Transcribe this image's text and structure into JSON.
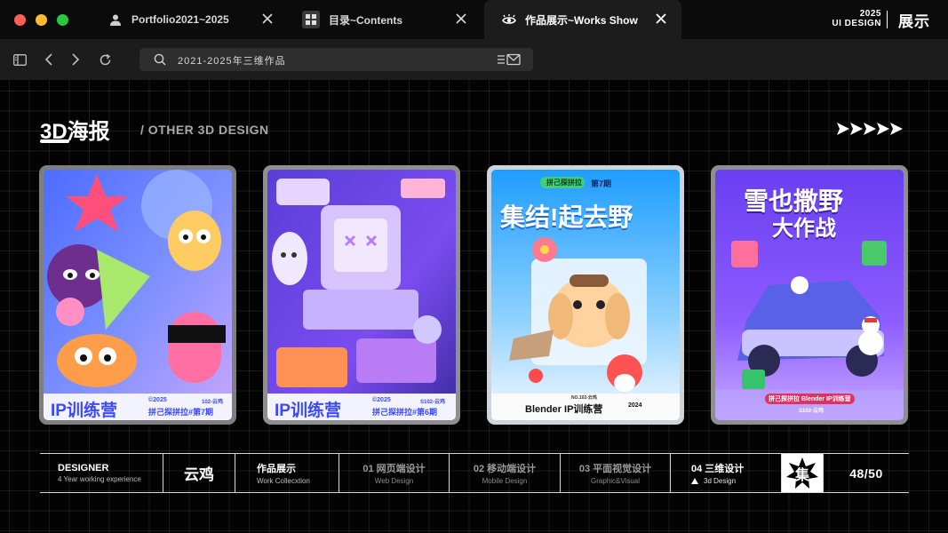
{
  "window": {
    "lights": [
      "#fe5f57",
      "#febc2e",
      "#28c840"
    ]
  },
  "tabs": [
    {
      "label": "Portfolio2021~2025",
      "icon": "user-icon"
    },
    {
      "label": "目录~Contents",
      "icon": "grid-icon"
    },
    {
      "label": "作品展示~Works Show",
      "icon": "eye-icon"
    }
  ],
  "brand": {
    "year": "2025",
    "title": "UI DESIGN",
    "mark": "展示"
  },
  "address": {
    "text": "2021-2025年三维作品"
  },
  "section": {
    "title": "3D海报",
    "subtitle": "/ OTHER 3D DESIGN"
  },
  "cards": [
    {
      "badge": "IP训练营",
      "series": "拼己探拼拉#第7期",
      "code": "102-云鸡",
      "year": "©2025",
      "frame": "#7f7f7f"
    },
    {
      "badge": "IP训练营",
      "series": "拼己探拼拉#第6期",
      "code": "S102-云鸡",
      "year": "©2025",
      "frame": "#8f8f8f"
    },
    {
      "title": "集结!起去野",
      "tag": "拼己探拼拉",
      "issue": "第7期",
      "credit": "NO.102-云鸡",
      "footer": "Blender IP训练营",
      "year": "2024",
      "frame": "#cfd4da"
    },
    {
      "title": "雪也撒野",
      "title2": "大作战",
      "footer": "拼己探拼拉 Blender IP训练营",
      "code": "S102-云鸡",
      "frame": "#8f8f8f"
    }
  ],
  "nav": {
    "designer_title": "DESIGNER",
    "designer_sub": "4 Year working experience",
    "name": "云鸡",
    "works_title": "作品展示",
    "works_sub": "Work Collecxtion",
    "items": [
      {
        "main": "01 网页端设计",
        "sub": "Web Design"
      },
      {
        "main": "02 移动端设计",
        "sub": "Mobile Design"
      },
      {
        "main": "03 平面视觉设计",
        "sub": "Graphic&Visual"
      },
      {
        "main": "04 三维设计",
        "sub": "3d Design"
      }
    ],
    "logo": "集",
    "page": "48/50"
  }
}
